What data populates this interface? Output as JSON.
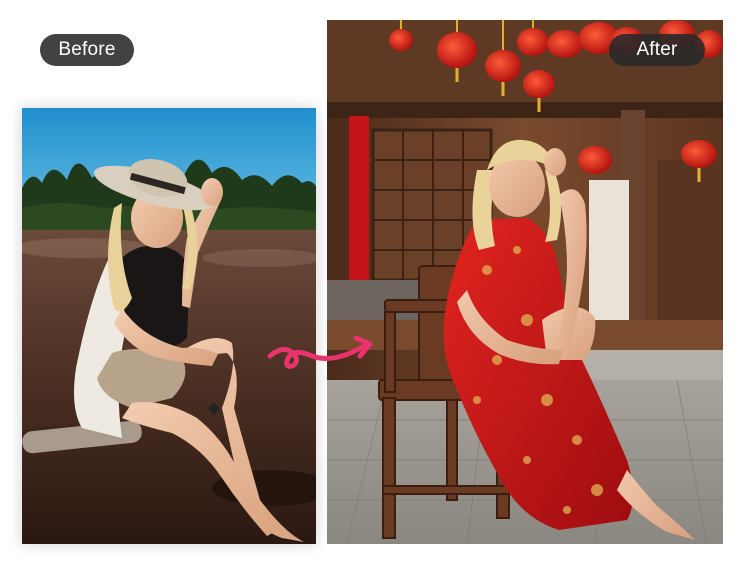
{
  "labels": {
    "before": "Before",
    "after": "After"
  },
  "colors": {
    "badge_background": "#2a2a2a",
    "badge_text": "#ffffff",
    "arrow": "#e8336d",
    "sky": "#2f9fd6",
    "dress_red": "#c8101e",
    "lantern_red": "#d8241c",
    "wood": "#7a4a2e"
  },
  "images": {
    "before": "photo-before",
    "after": "photo-after"
  },
  "icons": {
    "transform_arrow": "swirl-arrow-icon"
  }
}
